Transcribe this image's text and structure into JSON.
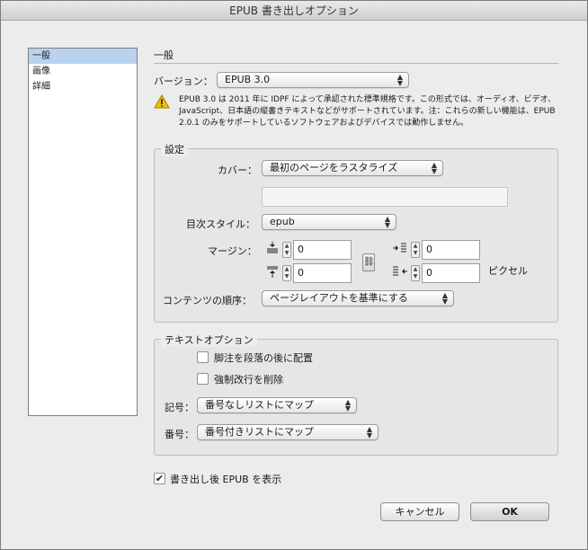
{
  "window": {
    "title": "EPUB 書き出しオプション"
  },
  "sidebar": {
    "items": [
      {
        "label": "一般",
        "selected": true
      },
      {
        "label": "画像",
        "selected": false
      },
      {
        "label": "詳細",
        "selected": false
      }
    ]
  },
  "general": {
    "section_title": "一般",
    "version_label": "バージョン：",
    "version_value": "EPUB 3.0",
    "warning_icon": "warning-icon",
    "warning_text": "EPUB 3.0 は 2011 年に IDPF によって承認された標準規格です。この形式では、オーディオ、ビデオ、JavaScript、日本語の縦書きテキストなどがサポートされています。注：これらの新しい機能は、EPUB 2.0.1 のみをサポートしているソフトウェアおよびデバイスでは動作しません。"
  },
  "settings": {
    "group_title": "設定",
    "cover_label": "カバー：",
    "cover_value": "最初のページをラスタライズ",
    "cover_path_value": "",
    "toc_label": "目次スタイル：",
    "toc_value": "epub",
    "margin_label": "マージン：",
    "margin_top": "0",
    "margin_bottom": "0",
    "margin_left": "0",
    "margin_right": "0",
    "margin_unit": "ピクセル",
    "order_label": "コンテンツの順序：",
    "order_value": "ページレイアウトを基準にする"
  },
  "text_options": {
    "group_title": "テキストオプション",
    "footnote_label": "脚注を段落の後に配置",
    "footnote_checked": false,
    "remove_breaks_label": "強制改行を削除",
    "remove_breaks_checked": false,
    "bullets_label": "記号：",
    "bullets_value": "番号なしリストにマップ",
    "numbers_label": "番号：",
    "numbers_value": "番号付きリストにマップ"
  },
  "footer": {
    "view_after_export_label": "書き出し後 EPUB を表示",
    "view_after_export_checked": true,
    "cancel_label": "キャンセル",
    "ok_label": "OK"
  }
}
